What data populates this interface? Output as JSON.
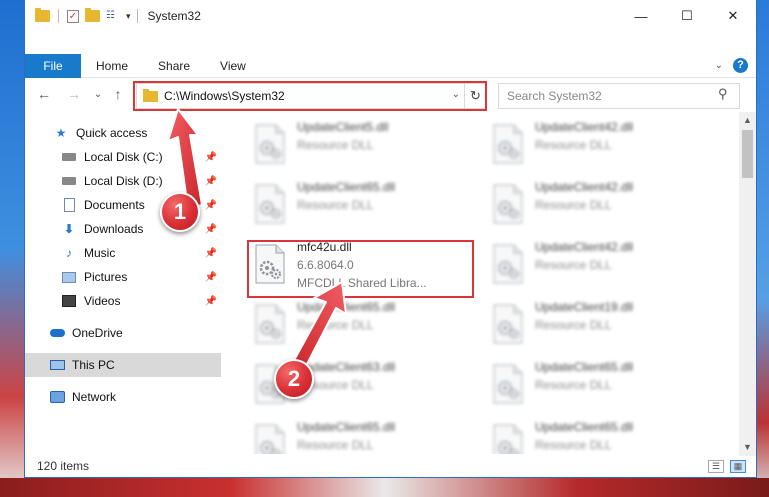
{
  "window": {
    "title": "System32",
    "controls": {
      "minimize": "—",
      "maximize": "☐",
      "close": "✕"
    }
  },
  "qat": {
    "dropdown": "▾"
  },
  "ribbon": {
    "tabs": [
      "File",
      "Home",
      "Share",
      "View"
    ],
    "expand_icon": "⌄",
    "help": "?"
  },
  "nav": {
    "back": "←",
    "forward": "→",
    "recent": "⌄",
    "up": "↑"
  },
  "address": {
    "path": "C:\\Windows\\System32",
    "dropdown": "⌄",
    "refresh": "↻"
  },
  "search": {
    "placeholder": "Search System32",
    "icon": "⚲"
  },
  "sidebar": {
    "items": [
      {
        "label": "Quick access",
        "icon": "star-icon",
        "pinned": false
      },
      {
        "label": "Local Disk (C:)",
        "icon": "disk-icon",
        "pinned": true
      },
      {
        "label": "Local Disk (D:)",
        "icon": "disk-icon",
        "pinned": true
      },
      {
        "label": "Documents",
        "icon": "documents-icon",
        "pinned": true
      },
      {
        "label": "Downloads",
        "icon": "downloads-icon",
        "pinned": true
      },
      {
        "label": "Music",
        "icon": "music-icon",
        "pinned": true
      },
      {
        "label": "Pictures",
        "icon": "pictures-icon",
        "pinned": true
      },
      {
        "label": "Videos",
        "icon": "videos-icon",
        "pinned": true
      },
      {
        "label": "OneDrive",
        "icon": "onedrive-icon",
        "pinned": false
      },
      {
        "label": "This PC",
        "icon": "this-pc-icon",
        "pinned": false,
        "selected": true
      },
      {
        "label": "Network",
        "icon": "network-icon",
        "pinned": false
      }
    ],
    "pin_glyph": "📌"
  },
  "files": {
    "left": [
      {
        "name": "UpdateClient5.dll",
        "desc": "Resource DLL"
      },
      {
        "name": "UpdateClient65.dll",
        "desc": "Resource DLL"
      },
      {
        "name": "mfc42u.dll",
        "version": "6.6.8064.0",
        "desc": "MFCDLL Shared Libra..."
      },
      {
        "name": "UpdateClient65.dll",
        "desc": "Resource DLL"
      },
      {
        "name": "UpdateClient63.dll",
        "desc": "Resource DLL"
      },
      {
        "name": "UpdateClient65.dll",
        "desc": "Resource DLL"
      }
    ],
    "right": [
      {
        "name": "UpdateClient42.dll",
        "desc": "Resource DLL"
      },
      {
        "name": "UpdateClient42.dll",
        "desc": "Resource DLL"
      },
      {
        "name": "UpdateClient42.dll",
        "desc": "Resource DLL"
      },
      {
        "name": "UpdateClient19.dll",
        "desc": "Resource DLL"
      },
      {
        "name": "UpdateClient65.dll",
        "desc": "Resource DLL"
      },
      {
        "name": "UpdateClient65.dll",
        "desc": "Resource DLL"
      }
    ]
  },
  "status": {
    "count": "120 items"
  },
  "scroll": {
    "up": "▲",
    "down": "▼"
  },
  "views": {
    "details": "☰",
    "tiles": "▦"
  },
  "callouts": {
    "one": "1",
    "two": "2"
  },
  "colors": {
    "accent": "#1979ca",
    "highlight": "#d9363a",
    "callout": "#d92f35"
  }
}
